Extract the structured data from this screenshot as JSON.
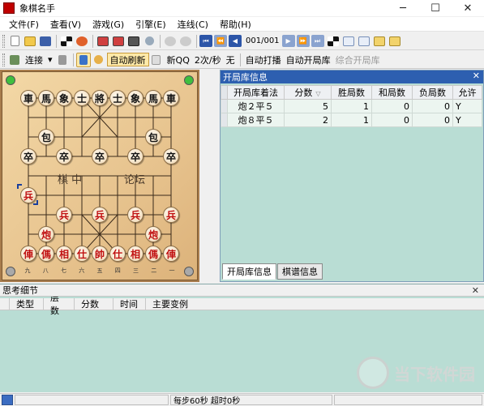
{
  "window": {
    "title": "象棋名手",
    "controls": [
      "─",
      "☐",
      "✕"
    ]
  },
  "menu": [
    "文件(F)",
    "查看(V)",
    "游戏(G)",
    "引擎(E)",
    "连线(C)",
    "帮助(H)"
  ],
  "toolbar1": {
    "page_indicator": "001/001"
  },
  "toolbar2": {
    "connect_label": "连接",
    "auto_refresh_label": "自动刷新",
    "qq_info": "新QQ",
    "rate": "2次/秒",
    "none_label": "无",
    "auto_play_label": "自动打播",
    "auto_opening_label": "自动开局库",
    "combined_opening_label": "综合开局库"
  },
  "board": {
    "river_left": "棋  中",
    "river_right": "论坛",
    "file_labels": [
      "九",
      "八",
      "七",
      "六",
      "五",
      "四",
      "三",
      "二",
      "一"
    ],
    "black_pieces": [
      "車",
      "馬",
      "象",
      "士",
      "將",
      "士",
      "象",
      "馬",
      "車",
      "包",
      "包",
      "卒",
      "卒",
      "卒",
      "卒",
      "卒"
    ],
    "red_pieces": [
      "兵",
      "兵",
      "兵",
      "兵",
      "兵",
      "炮",
      "炮",
      "俥",
      "傌",
      "相",
      "仕",
      "帥",
      "仕",
      "相",
      "傌",
      "俥"
    ]
  },
  "opening_panel": {
    "title": "开局库信息",
    "close": "✕",
    "columns": [
      "开局库着法",
      "分数",
      "胜局数",
      "和局数",
      "负局数",
      "允许"
    ],
    "rows": [
      {
        "move": "炮２平５",
        "score": "5",
        "wins": "1",
        "draws": "0",
        "losses": "0",
        "allow": "Y"
      },
      {
        "move": "炮８平５",
        "score": "2",
        "wins": "1",
        "draws": "0",
        "losses": "0",
        "allow": "Y"
      }
    ],
    "tabs": [
      "开局库信息",
      "棋谱信息"
    ]
  },
  "think_panel": {
    "title": "思考细节",
    "close": "✕",
    "columns": [
      "类型",
      "层数",
      "分数",
      "时间",
      "主要变例"
    ]
  },
  "status": {
    "time_info": "每步60秒  超时0秒"
  },
  "watermark": {
    "text": "当下软件园"
  }
}
